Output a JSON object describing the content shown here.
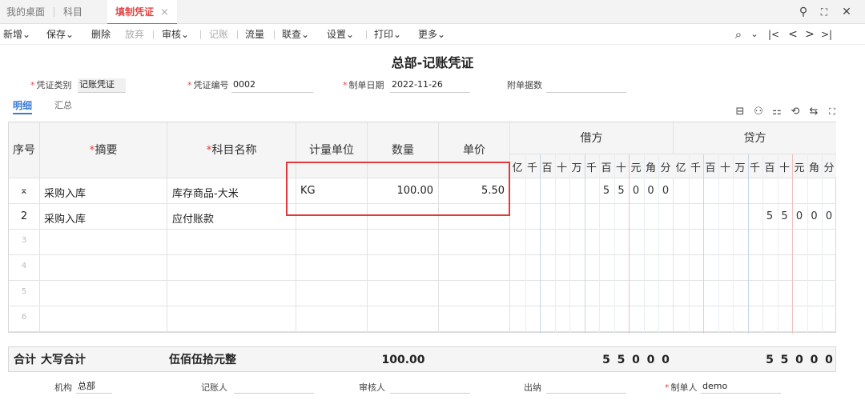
{
  "tabs": [
    {
      "label": "我的桌面"
    },
    {
      "label": "科目"
    },
    {
      "label": "填制凭证",
      "close": "×"
    }
  ],
  "window_controls": {
    "search": "⚲",
    "maximize": "⛶",
    "close": "✕"
  },
  "toolbar": {
    "items": [
      "新增",
      "保存",
      "删除",
      "放弃",
      "审核",
      "记账",
      "流量",
      "联查",
      "设置",
      "打印",
      "更多"
    ],
    "caret": "⌄"
  },
  "nav": {
    "find": "⌕",
    "first": "|<",
    "prev": "<",
    "next": ">",
    "last": ">|"
  },
  "voucher": {
    "title": "总部-记账凭证",
    "type_label": "凭证类别",
    "type_value": "记账凭证",
    "number_label": "凭证编号",
    "number_value": "0002",
    "date_label": "制单日期",
    "date_value": "2022-11-26",
    "attach_label": "附单据数",
    "attach_value": ""
  },
  "subtabs": [
    "明细",
    "汇总"
  ],
  "grid_tools": [
    "⊟",
    "⚇",
    "⚏",
    "⟲",
    "⇆",
    "⛶"
  ],
  "columns": {
    "seq": "序号",
    "summary": "摘要",
    "account": "科目名称",
    "unit": "计量单位",
    "qty": "数量",
    "price": "单价",
    "debit": "借方",
    "credit": "贷方",
    "digits": [
      "亿",
      "千",
      "百",
      "十",
      "万",
      "千",
      "百",
      "十",
      "元",
      "角",
      "分"
    ]
  },
  "rows": [
    {
      "seq": "⌅",
      "summary": "采购入库",
      "account": "库存商品-大米",
      "unit": "KG",
      "qty": "100.00",
      "price": "5.50",
      "debit": [
        "",
        "",
        "",
        "",
        "",
        "",
        "5",
        "5",
        "0",
        "0",
        "0"
      ],
      "credit": [
        "",
        "",
        "",
        "",
        "",
        "",
        "",
        "",
        "",
        "",
        ""
      ]
    },
    {
      "seq": "2",
      "summary": "采购入库",
      "account": "应付账款",
      "unit": "",
      "qty": "",
      "price": "",
      "debit": [
        "",
        "",
        "",
        "",
        "",
        "",
        "",
        "",
        "",
        "",
        ""
      ],
      "credit": [
        "",
        "",
        "",
        "",
        "",
        "",
        "5",
        "5",
        "0",
        "0",
        "0"
      ]
    },
    {
      "seq": "3"
    },
    {
      "seq": "4"
    },
    {
      "seq": "5"
    },
    {
      "seq": "6"
    }
  ],
  "totals": {
    "label": "合计",
    "caps_label": "大写合计",
    "caps_value": "伍佰伍拾元整",
    "qty": "100.00",
    "debit": [
      "",
      "",
      "",
      "",
      "",
      "",
      "5",
      "5",
      "0",
      "0",
      "0"
    ],
    "credit": [
      "",
      "",
      "",
      "",
      "",
      "",
      "5",
      "5",
      "0",
      "0",
      "0"
    ]
  },
  "footer": {
    "org_label": "机构",
    "org_value": "总部",
    "poster_label": "记账人",
    "poster_value": "",
    "auditor_label": "审核人",
    "auditor_value": "",
    "cashier_label": "出纳",
    "cashier_value": "",
    "maker_label": "制单人",
    "maker_value": "demo"
  },
  "colors": {
    "accent": "#e04848",
    "blue": "#3a7bd5",
    "highlight": "#fff8dc",
    "box": "#e03a3a"
  }
}
